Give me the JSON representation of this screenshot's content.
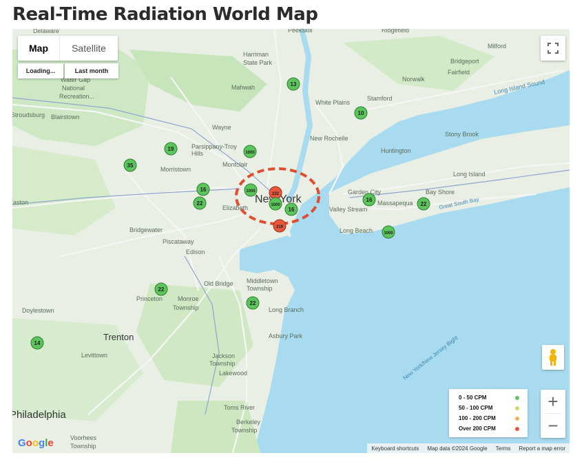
{
  "page": {
    "title": "Real-Time Radiation World Map"
  },
  "controls": {
    "map_type": [
      "Map",
      "Satellite"
    ],
    "time_range": [
      "Loading...",
      "Last month"
    ]
  },
  "place_labels": {
    "small": [
      "Delaware",
      "Water Gap",
      "National",
      "Recreation...",
      "Stroudsburg",
      "Blairstown",
      "Mahwah",
      "Wayne",
      "Parsippany-Troy",
      "Hills",
      "Morristown",
      "Montclair",
      "Elizabeth",
      "Bridgewater",
      "Piscataway",
      "Edison",
      "Old Bridge",
      "Princeton",
      "Monroe",
      "Township",
      "Doylestown",
      "Levittown",
      "Jackson",
      "Township",
      "Lakewood",
      "Toms River",
      "Berkeley",
      "Township",
      "Voorhees",
      "Township",
      "Middletown",
      "Township",
      "Long Branch",
      "Asbury Park",
      "Harriman",
      "State Park",
      "Peekskill",
      "Ridgefield",
      "Milford",
      "Bridgeport",
      "Fairfield",
      "Norwalk",
      "Stamford",
      "White Plains",
      "New Rochelle",
      "Huntington",
      "Stony Brook",
      "Long Island",
      "Garden City",
      "Bay Shore",
      "Massapequa",
      "Valley Stream",
      "Long Beach",
      "Easton"
    ],
    "city_major": [
      "New York",
      "Trenton",
      "Philadelphia"
    ],
    "water": [
      "Long Island Sound",
      "Great South Bay",
      "New York/New Jersey Bight"
    ]
  },
  "markers": [
    {
      "value": "13",
      "level": "low"
    },
    {
      "value": "10",
      "level": "low"
    },
    {
      "value": "19",
      "level": "low"
    },
    {
      "value": "35",
      "level": "low"
    },
    {
      "value": "1000",
      "level": "low"
    },
    {
      "value": "16",
      "level": "low"
    },
    {
      "value": "22",
      "level": "low"
    },
    {
      "value": "1000",
      "level": "low"
    },
    {
      "value": "222",
      "level": "high"
    },
    {
      "value": "1000",
      "level": "low"
    },
    {
      "value": "16",
      "level": "low"
    },
    {
      "value": "219",
      "level": "high"
    },
    {
      "value": "16",
      "level": "low"
    },
    {
      "value": "22",
      "level": "low"
    },
    {
      "value": "1000",
      "level": "low"
    },
    {
      "value": "22",
      "level": "low"
    },
    {
      "value": "22",
      "level": "low"
    },
    {
      "value": "14",
      "level": "low"
    }
  ],
  "legend": {
    "items": [
      {
        "label": "0 - 50 CPM",
        "color": "#5cc45c"
      },
      {
        "label": "50 - 100 CPM",
        "color": "#c9d96b"
      },
      {
        "label": "100 - 200 CPM",
        "color": "#f0b25a"
      },
      {
        "label": "Over 200 CPM",
        "color": "#e8573c"
      }
    ]
  },
  "attribution": [
    "Keyboard shortcuts",
    "Map data ©2024 Google",
    "Terms",
    "Report a map error"
  ],
  "logo": "Google",
  "colors": {
    "water": "#a8dbef",
    "land": "#e9efe4",
    "park": "#bfe3b4",
    "highlight": "#e04e2f"
  }
}
